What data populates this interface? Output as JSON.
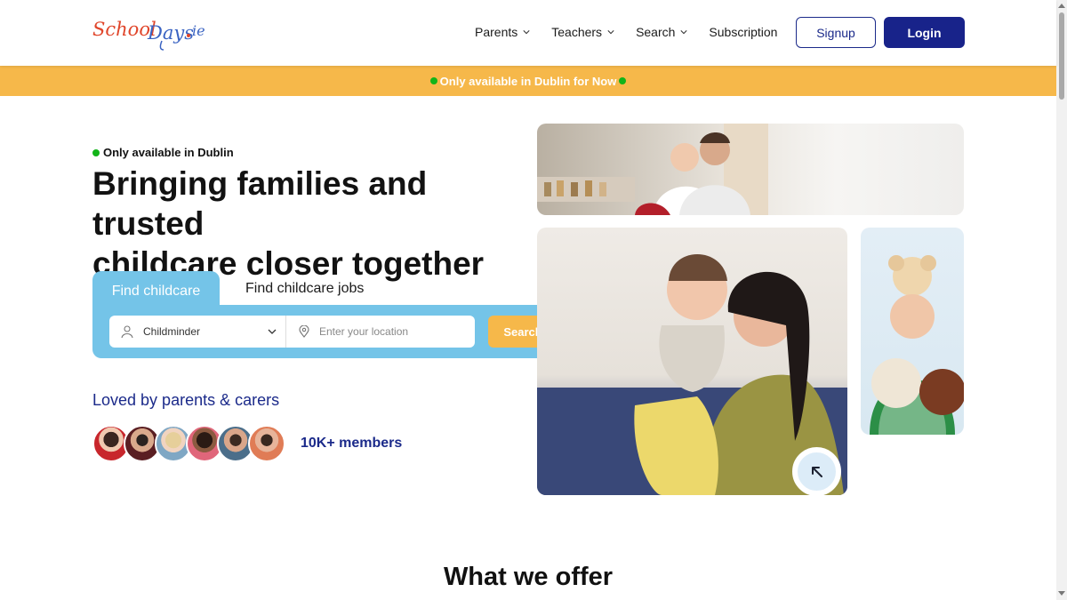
{
  "brand": {
    "logo_text": "SchoolDays.ie"
  },
  "nav": {
    "items": [
      {
        "label": "Parents",
        "has_dropdown": true
      },
      {
        "label": "Teachers",
        "has_dropdown": true
      },
      {
        "label": "Search",
        "has_dropdown": true
      },
      {
        "label": "Subscription",
        "has_dropdown": false
      }
    ],
    "signup_label": "Signup",
    "login_label": "Login"
  },
  "banner": {
    "text": "Only available in Dublin for Now"
  },
  "hero": {
    "availability": "Only available in Dublin",
    "title_line1": "Bringing families and trusted",
    "title_line2": "childcare closer together",
    "tabs": [
      {
        "label": "Find childcare",
        "active": true
      },
      {
        "label": "Find childcare jobs",
        "active": false
      }
    ],
    "search": {
      "type_value": "Childminder",
      "location_placeholder": "Enter your location",
      "button_label": "Search"
    },
    "loved_label": "Loved by parents & carers",
    "members_label": "10K+ members"
  },
  "section": {
    "what_we_offer": "What we offer"
  },
  "colors": {
    "brand_navy": "#18238a",
    "banner_orange": "#f6b84a",
    "tab_blue": "#74c4e8",
    "status_green": "#12b419"
  },
  "icons": [
    "chevron-down-icon",
    "person-icon",
    "location-pin-icon",
    "arrow-up-left-icon",
    "status-dot-icon"
  ]
}
